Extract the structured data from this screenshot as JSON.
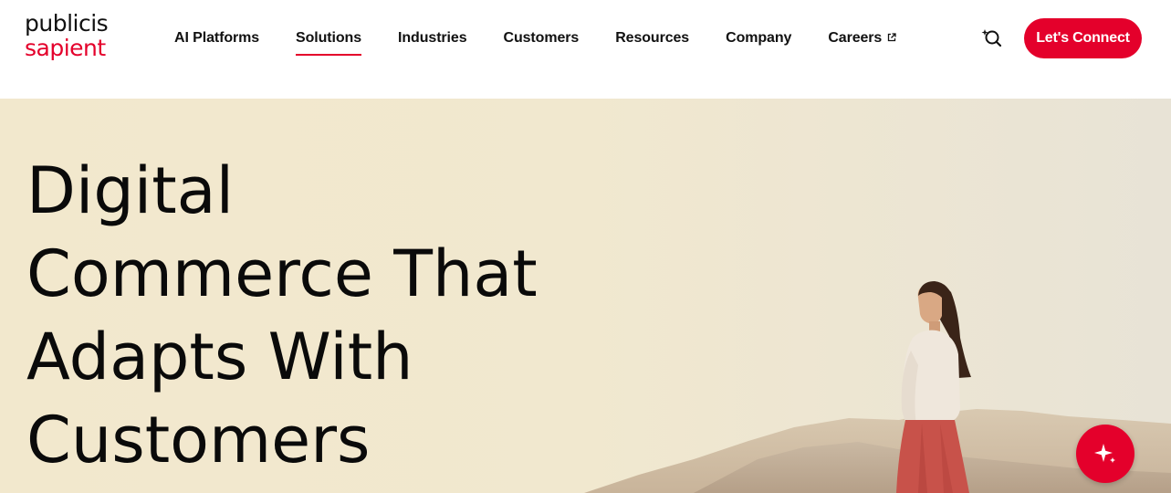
{
  "logo": {
    "line1": "publicis",
    "line2": "sapient"
  },
  "nav": {
    "items": [
      {
        "label": "AI Platforms"
      },
      {
        "label": "Solutions"
      },
      {
        "label": "Industries"
      },
      {
        "label": "Customers"
      },
      {
        "label": "Resources"
      },
      {
        "label": "Company"
      },
      {
        "label": "Careers"
      }
    ],
    "active": "Solutions"
  },
  "header": {
    "connect_label": "Let's Connect"
  },
  "hero": {
    "title_lines": [
      "Digital",
      "Commerce That",
      "Adapts With",
      "Customers"
    ]
  },
  "colors": {
    "brand": "#e4002b",
    "hero_bg": "#f2e9cf",
    "text": "#0a0a0a"
  },
  "icons": {
    "search": "ai-search-icon",
    "external": "external-link-icon",
    "assistant": "sparkle-icon"
  }
}
